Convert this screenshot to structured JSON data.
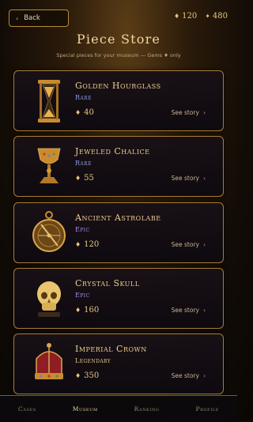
{
  "header": {
    "back_label": "Back",
    "gems_amount": "120",
    "coins_amount": "480",
    "title": "Piece Store",
    "subtitle": "Special pieces for your museum — Gems ♦ only"
  },
  "items": [
    {
      "name": "Golden Hourglass",
      "rarity": "Rare",
      "price": "40",
      "icon": "hourglass-icon"
    },
    {
      "name": "Jeweled Chalice",
      "rarity": "Rare",
      "price": "55",
      "icon": "chalice-icon"
    },
    {
      "name": "Ancient Astrolabe",
      "rarity": "Epic",
      "price": "120",
      "icon": "astrolabe-icon"
    },
    {
      "name": "Crystal Skull",
      "rarity": "Epic",
      "price": "160",
      "icon": "skull-icon"
    },
    {
      "name": "Imperial Crown",
      "rarity": "Legendary",
      "price": "350",
      "icon": "crown-icon"
    }
  ],
  "story_label": "See story",
  "nav": [
    "Cases",
    "Museum",
    "Ranking",
    "Profile"
  ],
  "active_nav": "Museum",
  "colors": {
    "gold": "#e6c98a",
    "rare": "#8f9be6",
    "epic": "#b08df0",
    "legendary": "#e7cb8c"
  }
}
